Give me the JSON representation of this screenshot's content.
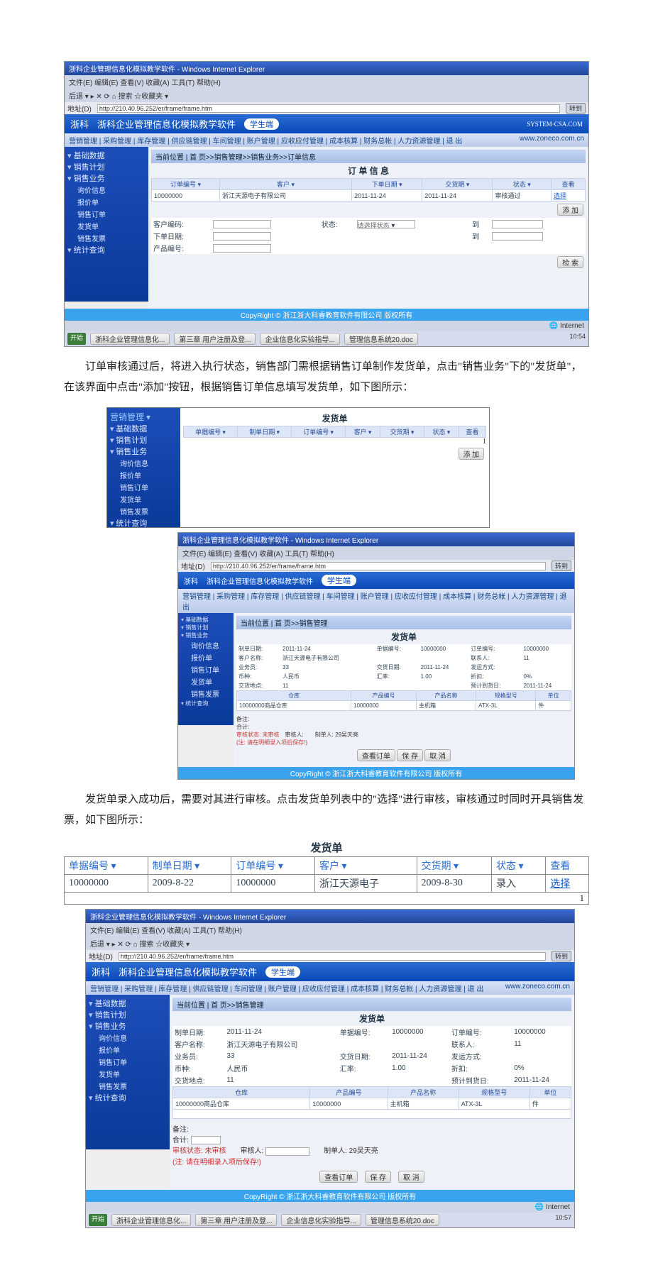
{
  "ie": {
    "appTitle": "浙科企业管理信息化模拟教学软件 - Windows Internet Explorer",
    "menu": "文件(E)  编辑(E)  查看(V)  收藏(A)  工具(T)  帮助(H)",
    "url": "http://210.40.96.252/er/frame/frame.htm",
    "go": "转到",
    "nav": "后退 ▾  ▸  ✕  ⟳  ⌂  搜索  ☆收藏夹 ▾"
  },
  "banner": {
    "logo": "浙科",
    "title": "浙科企业管理信息化模拟教学软件",
    "badge": "学生端",
    "right": "SYSTEM·CSA.COM"
  },
  "topnav": "营销管理 | 采购管理 | 库存管理 | 供应链管理 | 车间管理 | 账户管理 | 应收应付管理 | 成本核算 | 财务总帐 | 人力资源管理 | 退 出",
  "url": "www.zoneco.com.cn",
  "side": {
    "h1": "基础数据",
    "h2": "销售计划",
    "h3": "销售业务",
    "i1": "询价信息",
    "i2": "报价单",
    "i3": "销售订单",
    "i4": "发货单",
    "i5": "销售发票",
    "h4": "统计查询"
  },
  "shot1": {
    "crumb": "当前位置 | 首 页>>销售管理>>销售业务>>订单信息",
    "title": "订 单 信 息",
    "th": [
      "订单编号 ▾",
      "客户 ▾",
      "下单日期 ▾",
      "交货期 ▾",
      "状态 ▾",
      "查看"
    ],
    "row": [
      "10000000",
      "浙江天源电子有限公司",
      "2011-11-24",
      "2011-11-24",
      "审核通过",
      "选择"
    ],
    "flt": {
      "l1": "客户编码:",
      "l2": "状态:",
      "l2p": "请选择状态",
      "l3": "下单日期:",
      "l4": "产品编号:",
      "l5": "到",
      "l6": "到"
    },
    "add": "添 加",
    "retr": "检 索"
  },
  "para1": "订单审核通过后，将进入执行状态，销售部门需根据销售订单制作发货单，点击\"销售业务\"下的\"发货单\"，在该界面中点击\"添加\"按钮，根据销售订单信息填写发货单，如下图所示：",
  "shot2": {
    "title": "发货单",
    "th": [
      "单据编号 ▾",
      "制单日期 ▾",
      "订单编号 ▾",
      "客户 ▾",
      "交货期 ▾",
      "状态 ▾",
      "查看"
    ],
    "foot": "1",
    "add": "添 加"
  },
  "shot3": {
    "crumb": "当前位置 | 首 页>>销售管理",
    "title": "发货单",
    "f": {
      "制单日期": "2011-11-24",
      "单据编号": "10000000",
      "订单编号": "10000000",
      "客户名称": "浙江天源电子有限公司",
      "联系人": "11",
      "业务员": "33",
      "交货日期": "2011-11-24",
      "发运方式": "",
      "币种": "人民币",
      "汇率": "1.00",
      "折扣": "0%",
      "交货地点": "11",
      "预计到货日": "2011-11-24"
    },
    "grid": {
      "th": [
        "仓库",
        "产品编号",
        "产品名称",
        "规格型号",
        "单位"
      ],
      "row": [
        "10000000商品仓库",
        "10000000",
        "主机箱",
        "ATX-3L",
        "件"
      ]
    },
    "remark": "备注:",
    "sum": "合计:",
    "chk": "审核状态: 未审核",
    "chk2": "审核人:",
    "maker": "制单人: 29吴天亮",
    "note": "(注: 请在明细录入项后保存!)",
    "b1": "查看订单",
    "b2": "保 存",
    "b3": "取 消"
  },
  "para2": "发货单录入成功后，需要对其进行审核。点击发货单列表中的\"选择\"进行审核，审核通过时同时开具销售发票，如下图所示：",
  "tbl2": {
    "title": "发货单",
    "th": [
      "单据编号 ▾",
      "制单日期 ▾",
      "订单编号 ▾",
      "客户 ▾",
      "交货期 ▾",
      "状态 ▾",
      "查看"
    ],
    "row": [
      "10000000",
      "2009-8-22",
      "10000000",
      "浙江天源电子",
      "2009-8-30",
      "录入",
      "选择"
    ],
    "foot": "1"
  },
  "status": "CopyRight © 浙江浙大科睿教育软件有限公司 版权所有",
  "ie2": {
    "time": "10:54",
    "net": "Internet",
    "task": [
      "开始",
      "浙科企业管理信息化...",
      "第三章 用户注册及登...",
      "企业信息化实验指导...",
      "管理信息系统20.doc"
    ]
  },
  "ie3": {
    "time": "10:57"
  }
}
